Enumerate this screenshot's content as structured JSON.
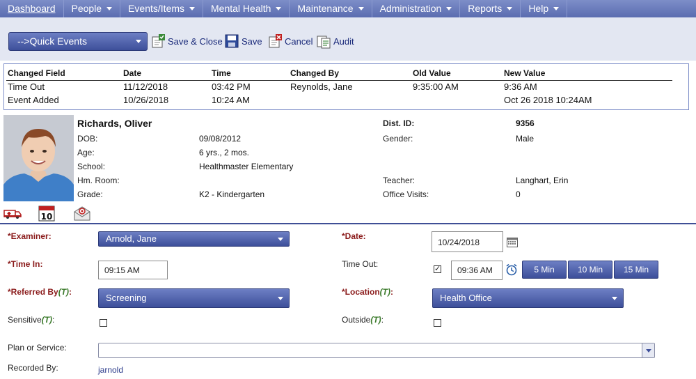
{
  "nav": {
    "items": [
      {
        "label": "Dashboard"
      },
      {
        "label": "People"
      },
      {
        "label": "Events/Items"
      },
      {
        "label": "Mental Health"
      },
      {
        "label": "Maintenance"
      },
      {
        "label": "Administration"
      },
      {
        "label": "Reports"
      },
      {
        "label": "Help"
      }
    ]
  },
  "toolbar": {
    "quick_events": "-->Quick Events",
    "save_close": "Save & Close",
    "save": "Save",
    "cancel": "Cancel",
    "audit": "Audit"
  },
  "audit_table": {
    "columns": [
      "Changed Field",
      "Date",
      "Time",
      "Changed By",
      "Old Value",
      "New Value"
    ],
    "rows": [
      [
        "Time Out",
        "11/12/2018",
        "03:42 PM",
        "Reynolds, Jane",
        "9:35:00 AM",
        "9:36 AM"
      ],
      [
        "Event Added",
        "10/26/2018",
        "10:24 AM",
        "",
        "",
        "Oct 26 2018 10:24AM"
      ]
    ]
  },
  "student": {
    "name": "Richards, Oliver",
    "dob_label": "DOB:",
    "dob": "09/08/2012",
    "age_label": "Age:",
    "age": "6 yrs., 2 mos.",
    "school_label": "School:",
    "school": "Healthmaster Elementary",
    "homeroom_label": "Hm. Room:",
    "homeroom": "",
    "grade_label": "Grade:",
    "grade": "K2 - Kindergarten",
    "dist_id_label": "Dist. ID:",
    "dist_id": "9356",
    "gender_label": "Gender:",
    "gender": "Male",
    "teacher_label": "Teacher:",
    "teacher": "Langhart, Erin",
    "office_visits_label": "Office Visits:",
    "office_visits": "0",
    "calendar_day": "10"
  },
  "form": {
    "examiner_label": "*Examiner:",
    "examiner": "Arnold, Jane",
    "date_label": "*Date:",
    "date": "10/24/2018",
    "time_in_label": "*Time In:",
    "time_in": "09:15 AM",
    "time_out_label": "Time Out:",
    "time_out": "09:36 AM",
    "time_out_checked": true,
    "min_buttons": [
      "5 Min",
      "10 Min",
      "15 Min"
    ],
    "referred_by_label": "*Referred By",
    "referred_by": "Screening",
    "location_label": "*Location",
    "location": "Health Office",
    "t_marker": "(T)",
    "sensitive_label": "Sensitive",
    "outside_label": "Outside",
    "plan_label": "Plan or Service:",
    "plan": "",
    "recorded_by_label": "Recorded By:",
    "recorded_by": "jarnold"
  },
  "colors": {
    "nav_bg": "#6a7bbd",
    "button_blue": "#4d5fa8",
    "required_label": "#8a1a1a",
    "t_marker": "#3a7a2a",
    "link_text": "#1a2a7a"
  }
}
